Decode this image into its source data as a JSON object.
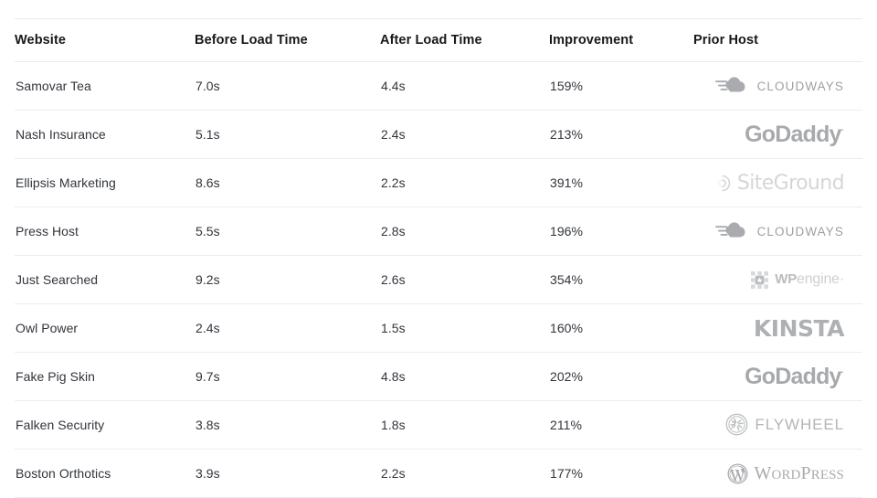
{
  "table": {
    "columns": [
      {
        "key": "website",
        "label": "Website"
      },
      {
        "key": "before",
        "label": "Before Load Time"
      },
      {
        "key": "after",
        "label": "After Load Time"
      },
      {
        "key": "improve",
        "label": "Improvement"
      },
      {
        "key": "host",
        "label": "Prior Host"
      }
    ],
    "rows": [
      {
        "website": "Samovar Tea",
        "before": "7.0s",
        "after": "4.4s",
        "improve": "159%",
        "host": "Cloudways",
        "host_icon": "cloudways-logo"
      },
      {
        "website": "Nash Insurance",
        "before": "5.1s",
        "after": "2.4s",
        "improve": "213%",
        "host": "GoDaddy",
        "host_icon": "godaddy-logo"
      },
      {
        "website": "Ellipsis Marketing",
        "before": "8.6s",
        "after": "2.2s",
        "improve": "391%",
        "host": "SiteGround",
        "host_icon": "siteground-logo"
      },
      {
        "website": "Press Host",
        "before": "5.5s",
        "after": "2.8s",
        "improve": "196%",
        "host": "Cloudways",
        "host_icon": "cloudways-logo"
      },
      {
        "website": "Just Searched",
        "before": "9.2s",
        "after": "2.6s",
        "improve": "354%",
        "host": "WP Engine",
        "host_icon": "wpengine-logo"
      },
      {
        "website": "Owl Power",
        "before": "2.4s",
        "after": "1.5s",
        "improve": "160%",
        "host": "Kinsta",
        "host_icon": "kinsta-logo"
      },
      {
        "website": "Fake Pig Skin",
        "before": "9.7s",
        "after": "4.8s",
        "improve": "202%",
        "host": "GoDaddy",
        "host_icon": "godaddy-logo"
      },
      {
        "website": "Falken Security",
        "before": "3.8s",
        "after": "1.8s",
        "improve": "211%",
        "host": "Flywheel",
        "host_icon": "flywheel-logo"
      },
      {
        "website": "Boston Orthotics",
        "before": "3.9s",
        "after": "2.2s",
        "improve": "177%",
        "host": "WordPress",
        "host_icon": "wordpress-logo"
      }
    ]
  },
  "wordmarks": {
    "cloudways": "CLOUDWAYS",
    "godaddy": "GoDaddy",
    "siteground": "SiteGround",
    "wpengine_bold": "WP",
    "wpengine_light": "engine",
    "kinsta": "KINSTA",
    "flywheel": "FLYWHEEL",
    "wordpress_w": "W",
    "wordpress_ord": "ORD",
    "wordpress_p": "P",
    "wordpress_ress": "RESS"
  },
  "colors": {
    "text": "#31353b",
    "header_text": "#16181a",
    "rule": "#ededee",
    "logo_grey": "#a9abae",
    "background": "#ffffff"
  }
}
